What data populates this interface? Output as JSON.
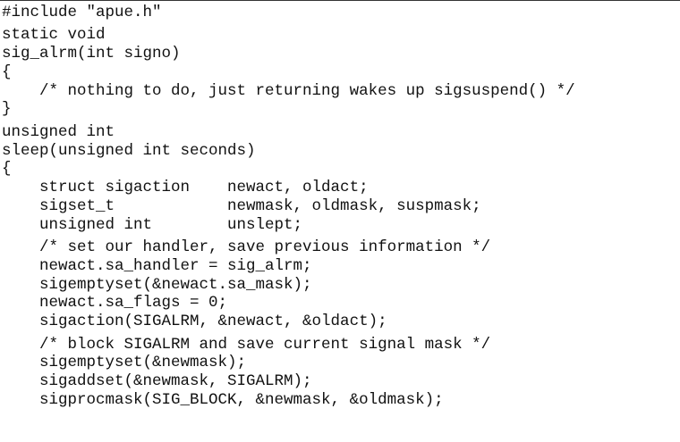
{
  "code": {
    "lines": [
      "#include \"apue.h\"",
      "static void",
      "sig_alrm(int signo)",
      "{",
      "    /* nothing to do, just returning wakes up sigsuspend() */",
      "}",
      "unsigned int",
      "sleep(unsigned int seconds)",
      "{",
      "    struct sigaction    newact, oldact;",
      "    sigset_t            newmask, oldmask, suspmask;",
      "    unsigned int        unslept;",
      "    /* set our handler, save previous information */",
      "    newact.sa_handler = sig_alrm;",
      "    sigemptyset(&newact.sa_mask);",
      "    newact.sa_flags = 0;",
      "    sigaction(SIGALRM, &newact, &oldact);",
      "    /* block SIGALRM and save current signal mask */",
      "    sigemptyset(&newmask);",
      "    sigaddset(&newmask, SIGALRM);",
      "    sigprocmask(SIG_BLOCK, &newmask, &oldmask);"
    ]
  }
}
